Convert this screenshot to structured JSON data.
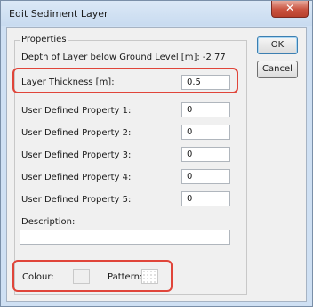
{
  "window": {
    "title": "Edit Sediment Layer",
    "close_glyph": "✕"
  },
  "buttons": {
    "ok_label": "OK",
    "cancel_label": "Cancel"
  },
  "properties": {
    "group_title": "Properties",
    "depth_label": "Depth of Layer below Ground Level [m]: -2.77",
    "rows": [
      {
        "label": "Layer Thickness [m]:",
        "value": "0.5"
      },
      {
        "label": "User Defined Property 1:",
        "value": "0"
      },
      {
        "label": "User Defined Property 2:",
        "value": "0"
      },
      {
        "label": "User Defined Property 3:",
        "value": "0"
      },
      {
        "label": "User Defined Property 4:",
        "value": "0"
      },
      {
        "label": "User Defined Property 5:",
        "value": "0"
      }
    ],
    "description_label": "Description:",
    "description_value": "",
    "colour_label": "Colour:",
    "pattern_label": "Pattern:"
  },
  "colors": {
    "colour_swatch": "#efefef",
    "highlight": "#e0453a"
  }
}
